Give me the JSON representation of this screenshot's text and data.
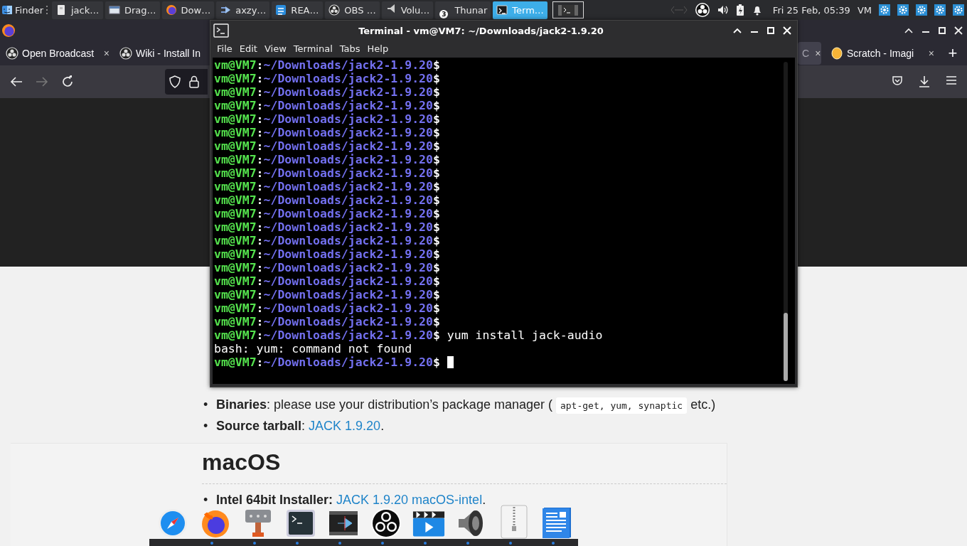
{
  "top_panel": {
    "launcher": {
      "label": "Finder"
    },
    "tasks": [
      {
        "label": "jack…",
        "selected": false
      },
      {
        "label": "Drag…",
        "selected": false
      },
      {
        "label": "Dow…",
        "selected": false
      },
      {
        "label": "axzy…",
        "selected": false
      },
      {
        "label": "REA…",
        "selected": false
      },
      {
        "label": "OBS …",
        "selected": false
      },
      {
        "label": "Volu…",
        "selected": false
      },
      {
        "label": "Thunar",
        "selected": false,
        "badge": "3"
      },
      {
        "label": "Term…",
        "selected": true
      }
    ],
    "clock": "Fri 25 Feb, 05:39",
    "user": "VM"
  },
  "browser": {
    "tabs": [
      {
        "label": "Open Broadcast",
        "selected": false,
        "close": "×"
      },
      {
        "label": "Wiki - Install In",
        "selected": false
      },
      {
        "label": "C",
        "selected": true,
        "close": "×"
      },
      {
        "label": "Scratch - Imagi",
        "selected": false,
        "close": "×"
      }
    ],
    "new_tab": "+",
    "page": {
      "items": [
        {
          "bullet": "•",
          "parts": [
            {
              "kind": "bold",
              "text": "Binaries"
            },
            {
              "kind": "text",
              "text": ": please use your distribution’s package manager ( "
            },
            {
              "kind": "code",
              "text": "apt-get, yum, synaptic"
            },
            {
              "kind": "text",
              "text": " etc.)"
            }
          ]
        },
        {
          "bullet": "•",
          "parts": [
            {
              "kind": "bold",
              "text": "Source tarball"
            },
            {
              "kind": "text",
              "text": ": "
            },
            {
              "kind": "link",
              "text": "JACK 1.9.20"
            },
            {
              "kind": "text",
              "text": "."
            }
          ]
        }
      ],
      "card": {
        "heading": "macOS",
        "items": [
          {
            "bullet": "•",
            "parts": [
              {
                "kind": "bold",
                "text": "Intel 64bit Installer: "
              },
              {
                "kind": "link",
                "text": "JACK 1.9.20 macOS-intel"
              },
              {
                "kind": "text",
                "text": "."
              }
            ]
          }
        ]
      }
    }
  },
  "terminal": {
    "title": "Terminal - vm@VM7: ~/Downloads/jack2-1.9.20",
    "menu": [
      "File",
      "Edit",
      "View",
      "Terminal",
      "Tabs",
      "Help"
    ],
    "lines": [
      {
        "kind": "prompt",
        "user": "vm@VM7",
        "sep": ":",
        "path": "~/Downloads/jack2-1.9.20",
        "sigil": "$",
        "cursor": false
      },
      {
        "kind": "prompt",
        "user": "vm@VM7",
        "sep": ":",
        "path": "~/Downloads/jack2-1.9.20",
        "sigil": "$",
        "cursor": false
      },
      {
        "kind": "prompt",
        "user": "vm@VM7",
        "sep": ":",
        "path": "~/Downloads/jack2-1.9.20",
        "sigil": "$",
        "cursor": false
      },
      {
        "kind": "prompt",
        "user": "vm@VM7",
        "sep": ":",
        "path": "~/Downloads/jack2-1.9.20",
        "sigil": "$",
        "cursor": false
      },
      {
        "kind": "prompt",
        "user": "vm@VM7",
        "sep": ":",
        "path": "~/Downloads/jack2-1.9.20",
        "sigil": "$",
        "cursor": false
      },
      {
        "kind": "prompt",
        "user": "vm@VM7",
        "sep": ":",
        "path": "~/Downloads/jack2-1.9.20",
        "sigil": "$",
        "cursor": false
      },
      {
        "kind": "prompt",
        "user": "vm@VM7",
        "sep": ":",
        "path": "~/Downloads/jack2-1.9.20",
        "sigil": "$",
        "cursor": false
      },
      {
        "kind": "prompt",
        "user": "vm@VM7",
        "sep": ":",
        "path": "~/Downloads/jack2-1.9.20",
        "sigil": "$",
        "cursor": false
      },
      {
        "kind": "prompt",
        "user": "vm@VM7",
        "sep": ":",
        "path": "~/Downloads/jack2-1.9.20",
        "sigil": "$",
        "cursor": false
      },
      {
        "kind": "prompt",
        "user": "vm@VM7",
        "sep": ":",
        "path": "~/Downloads/jack2-1.9.20",
        "sigil": "$",
        "cursor": false
      },
      {
        "kind": "prompt",
        "user": "vm@VM7",
        "sep": ":",
        "path": "~/Downloads/jack2-1.9.20",
        "sigil": "$",
        "cursor": false
      },
      {
        "kind": "prompt",
        "user": "vm@VM7",
        "sep": ":",
        "path": "~/Downloads/jack2-1.9.20",
        "sigil": "$",
        "cursor": false
      },
      {
        "kind": "prompt",
        "user": "vm@VM7",
        "sep": ":",
        "path": "~/Downloads/jack2-1.9.20",
        "sigil": "$",
        "cursor": false
      },
      {
        "kind": "prompt",
        "user": "vm@VM7",
        "sep": ":",
        "path": "~/Downloads/jack2-1.9.20",
        "sigil": "$",
        "cursor": false
      },
      {
        "kind": "prompt",
        "user": "vm@VM7",
        "sep": ":",
        "path": "~/Downloads/jack2-1.9.20",
        "sigil": "$",
        "cursor": false
      },
      {
        "kind": "prompt",
        "user": "vm@VM7",
        "sep": ":",
        "path": "~/Downloads/jack2-1.9.20",
        "sigil": "$",
        "cursor": false
      },
      {
        "kind": "prompt",
        "user": "vm@VM7",
        "sep": ":",
        "path": "~/Downloads/jack2-1.9.20",
        "sigil": "$",
        "cursor": false
      },
      {
        "kind": "prompt",
        "user": "vm@VM7",
        "sep": ":",
        "path": "~/Downloads/jack2-1.9.20",
        "sigil": "$",
        "cursor": false
      },
      {
        "kind": "prompt",
        "user": "vm@VM7",
        "sep": ":",
        "path": "~/Downloads/jack2-1.9.20",
        "sigil": "$",
        "cursor": false
      },
      {
        "kind": "prompt",
        "user": "vm@VM7",
        "sep": ":",
        "path": "~/Downloads/jack2-1.9.20",
        "sigil": "$",
        "cursor": false
      },
      {
        "kind": "prompt",
        "user": "vm@VM7",
        "sep": ":",
        "path": "~/Downloads/jack2-1.9.20",
        "sigil": "$",
        "command": "yum install jack-audio",
        "cursor": false
      },
      {
        "kind": "output",
        "text": "bash: yum: command not found"
      },
      {
        "kind": "prompt",
        "user": "vm@VM7",
        "sep": ":",
        "path": "~/Downloads/jack2-1.9.20",
        "sigil": "$",
        "cursor": true
      }
    ]
  }
}
